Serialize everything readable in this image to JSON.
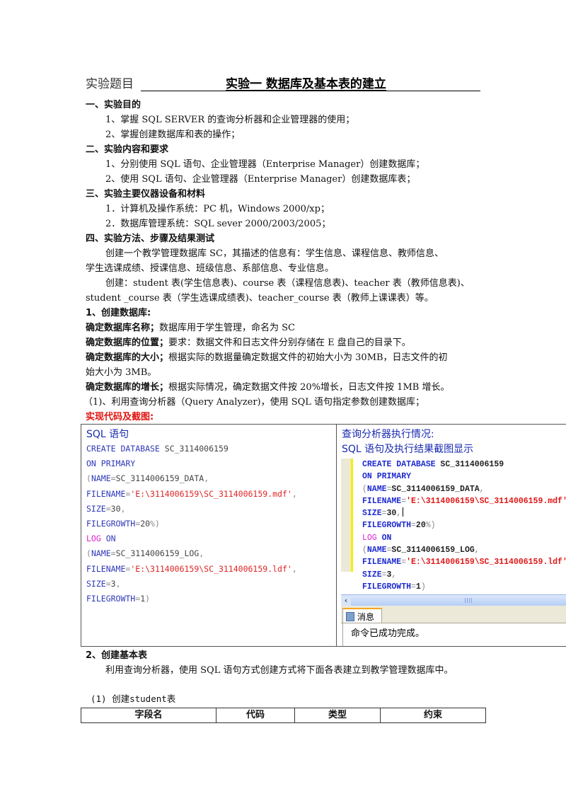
{
  "header": {
    "label": "实验题目",
    "title": "实验一  数据库及基本表的建立"
  },
  "sections": {
    "purpose": {
      "heading": "一、实验目的",
      "items": [
        "1、掌握 SQL SERVER 的查询分析器和企业管理器的使用；",
        "2、掌握创建数据库和表的操作；"
      ]
    },
    "content": {
      "heading": "二、实验内容和要求",
      "items": [
        "1、分别使用 SQL 语句、企业管理器（Enterprise Manager）创建数据库；",
        "2、使用 SQL 语句、企业管理器（Enterprise Manager）创建数据库表；"
      ]
    },
    "equipment": {
      "heading": "三、实验主要仪器设备和材料",
      "items": [
        "1．计算机及操作系统：PC 机，Windows 2000/xp；",
        "2．数据库管理系统：SQL sever 2000/2003/2005；"
      ]
    },
    "method": {
      "heading": "四、实验方法、步骤及结果测试",
      "paragraphs": [
        "创建一个教学管理数据库 SC，其描述的信息有：学生信息、课程信息、教师信息、",
        "学生选课成绩、授课信息、班级信息、系部信息、专业信息。",
        "创建：student 表(学生信息表)、course 表（课程信息表)、teacher 表（教师信息表)、",
        "student _course 表（学生选课成绩表)、teacher_course 表（教师上课课表）等。"
      ]
    }
  },
  "create_db": {
    "heading": "1、创建数据库:",
    "rules": [
      {
        "label": "确定数据库名称；",
        "text": "数据库用于学生管理，命名为 SC"
      },
      {
        "label": "确定数据库的位置；",
        "text": "要求：数据文件和日志文件分别存储在 E 盘自己的目录下。"
      },
      {
        "label": "确定数据库的大小；",
        "text": "根据实际的数据量确定数据文件的初始大小为 30MB，日志文件的初"
      },
      {
        "label": "",
        "text": "始大小为 3MB。"
      },
      {
        "label": "确定数据库的增长；",
        "text": "根据实际情况，确定数据文件按 20%增长，日志文件按 1MB 增长。"
      }
    ],
    "step": "（1)、利用查询分析器（Query Analyzer)，使用 SQL 语句指定参数创建数据库；",
    "code_label": "实现代码及截图:"
  },
  "code_panel": {
    "left_heading": "SQL 语句",
    "right_heading_1": "查询分析器执行情况:",
    "right_heading_2": "SQL 语句及执行结果截图显示",
    "sql_lines": [
      "CREATE DATABASE SC_3114006159",
      "ON PRIMARY",
      "(NAME=SC_3114006159_DATA,",
      "FILENAME='E:\\3114006159\\SC_3114006159.mdf',",
      "SIZE=30,",
      "FILEGROWTH=20%)",
      "LOG ON",
      "(NAME=SC_3114006159_LOG,",
      "FILENAME='E:\\3114006159\\SC_3114006159.ldf',",
      "SIZE=3,",
      "FILEGROWTH=1)"
    ],
    "screenshot": {
      "tab_label": "消息",
      "message": "命令已成功完成。"
    }
  },
  "create_tables": {
    "heading": "2、创建基本表",
    "text": "利用查询分析器，使用 SQL 语句方式创建方式将下面各表建立到教学管理数据库中。",
    "sub": "(1) 创建student表",
    "columns": [
      "字段名",
      "代码",
      "类型",
      "约束"
    ]
  }
}
